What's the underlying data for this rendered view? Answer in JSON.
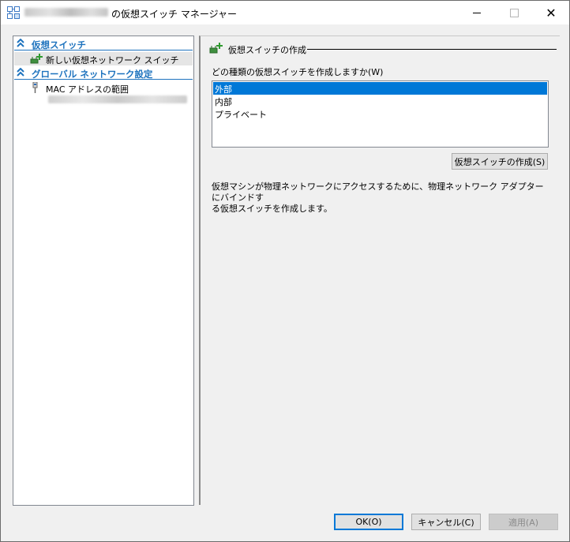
{
  "window": {
    "title_suffix": "の仮想スイッチ マネージャー",
    "minimize_icon": "minimize-icon",
    "maximize_icon": "maximize-icon",
    "close_glyph": "✕"
  },
  "left": {
    "sections": [
      {
        "label": "仮想スイッチ",
        "icon": "collapse-chevron-icon"
      },
      {
        "label": "グローバル ネットワーク設定",
        "icon": "collapse-chevron-icon"
      }
    ],
    "items": [
      {
        "label": "新しい仮想ネットワーク スイッチ",
        "icon": "new-switch-icon",
        "selected": true
      },
      {
        "label": "MAC アドレスの範囲",
        "icon": "network-cable-icon"
      }
    ]
  },
  "right": {
    "header": "仮想スイッチの作成",
    "question": "どの種類の仮想スイッチを作成しますか(W)",
    "switch_types": [
      "外部",
      "内部",
      "プライベート"
    ],
    "selected_type": "外部",
    "create_button": "仮想スイッチの作成(S)",
    "description_line1": "仮想マシンが物理ネットワークにアクセスするために、物理ネットワーク アダプターにバインドす",
    "description_line2": "る仮想スイッチを作成します。"
  },
  "footer": {
    "ok": "OK(O)",
    "cancel": "キャンセル(C)",
    "apply": "適用(A)"
  },
  "colors": {
    "accent": "#1e73be",
    "selection": "#0078d7"
  }
}
